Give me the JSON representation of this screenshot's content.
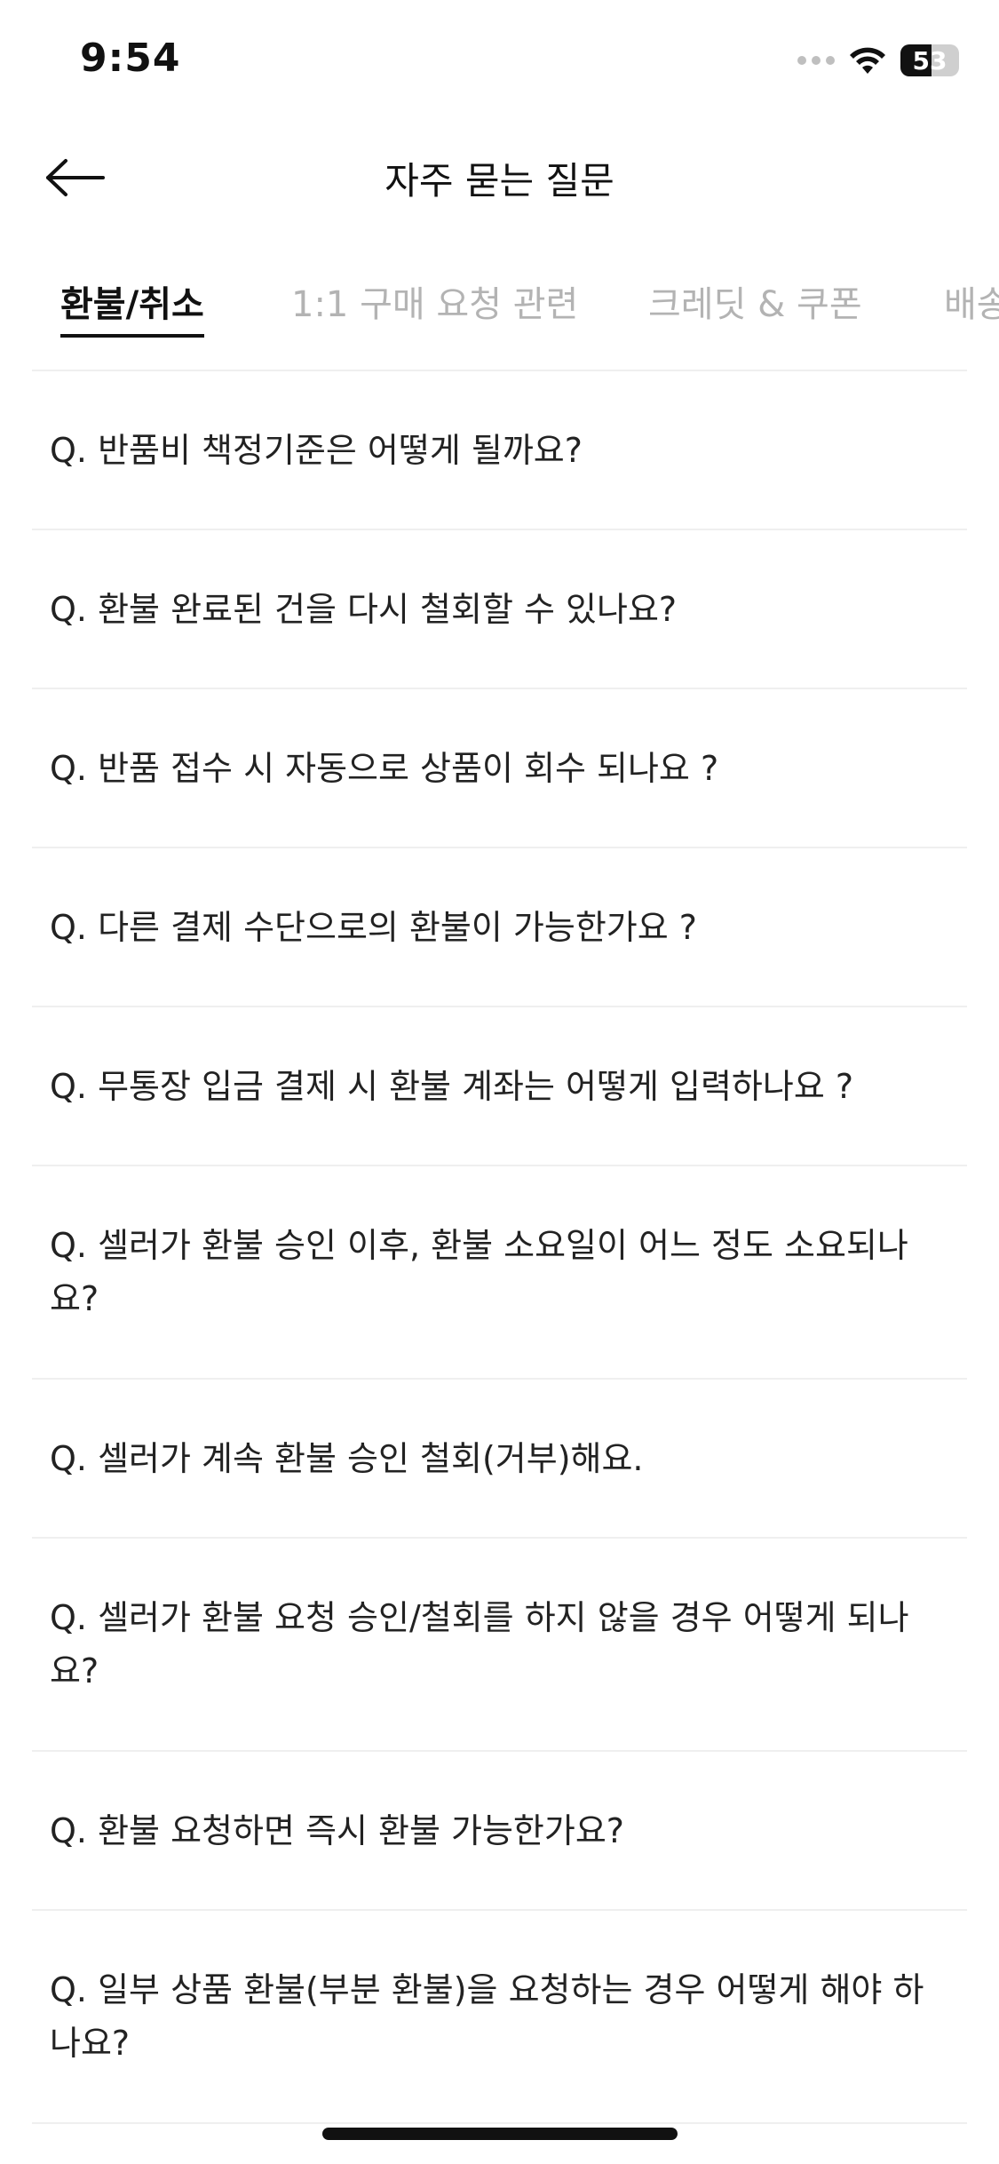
{
  "status_bar": {
    "time": "9:54",
    "battery_level": "53",
    "battery_fraction": 0.53,
    "wifi_icon": "wifi-icon",
    "signal_icon": "cellular-signal-icon"
  },
  "header": {
    "title": "자주 묻는 질문",
    "back_icon": "arrow-left-icon"
  },
  "tabs": [
    {
      "label": "환불/취소",
      "active": true
    },
    {
      "label": "1:1 구매 요청 관련",
      "active": false
    },
    {
      "label": "크레딧 & 쿠폰",
      "active": false
    },
    {
      "label": "배송",
      "active": false
    }
  ],
  "faq": [
    {
      "question": "Q. 반품비 책정기준은 어떻게 될까요?"
    },
    {
      "question": "Q. 환불 완료된 건을 다시 철회할 수 있나요?"
    },
    {
      "question": "Q. 반품 접수 시 자동으로 상품이 회수 되나요 ?"
    },
    {
      "question": "Q. 다른 결제 수단으로의 환불이 가능한가요 ?"
    },
    {
      "question": "Q. 무통장 입금 결제 시 환불 계좌는 어떻게 입력하나요 ?"
    },
    {
      "question": "Q. 셀러가 환불 승인 이후, 환불 소요일이 어느 정도 소요되나요?"
    },
    {
      "question": "Q. 셀러가 계속 환불 승인 철회(거부)해요."
    },
    {
      "question": "Q. 셀러가 환불 요청 승인/철회를 하지 않을 경우 어떻게 되나요?"
    },
    {
      "question": "Q. 환불 요청하면 즉시 환불 가능한가요?"
    },
    {
      "question": "Q. 일부 상품 환불(부분 환불)을 요청하는 경우 어떻게 해야 하나요?"
    }
  ],
  "colors": {
    "text_primary": "#111111",
    "text_inactive": "#b3b3b3",
    "divider": "#efefef"
  }
}
